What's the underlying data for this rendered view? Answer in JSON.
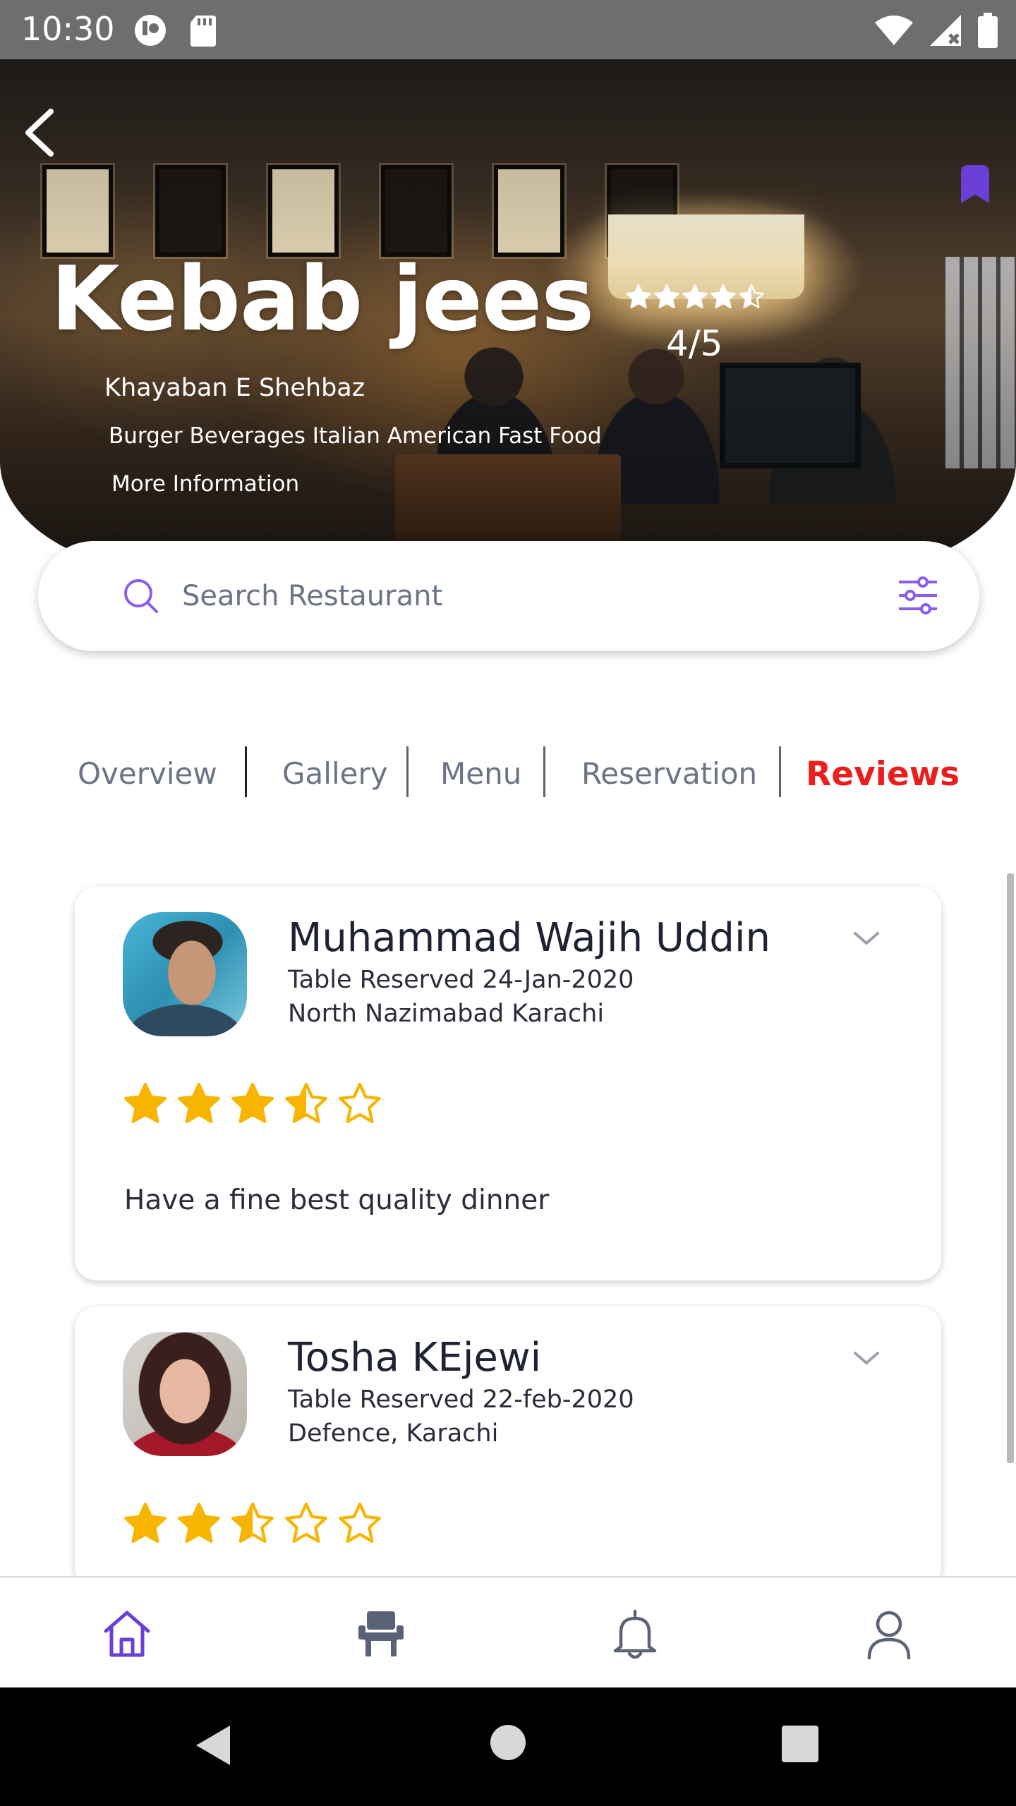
{
  "status_bar": {
    "time": "10:30"
  },
  "restaurant": {
    "name": "Kebab jees",
    "rating_text": "4/5",
    "rating_value": 4.5,
    "area": "Khayaban E Shehbaz",
    "cuisines": "Burger Beverages Italian American Fast Food",
    "more_info": "More Information"
  },
  "search": {
    "placeholder": "Search Restaurant"
  },
  "tabs": [
    {
      "label": "Overview",
      "active": false
    },
    {
      "label": "Gallery",
      "active": false
    },
    {
      "label": "Menu",
      "active": false
    },
    {
      "label": "Reservation",
      "active": false
    },
    {
      "label": "Reviews",
      "active": true
    }
  ],
  "reviews": [
    {
      "name": "Muhammad Wajih Uddin",
      "reserved": "Table Reserved 24-Jan-2020",
      "location": "North Nazimabad Karachi",
      "rating": 3.5,
      "comment": "Have a fine best quality dinner"
    },
    {
      "name": "Tosha KEjewi",
      "reserved": "Table Reserved 22-feb-2020",
      "location": "Defence, Karachi",
      "rating": 2.5,
      "comment": ""
    }
  ],
  "bottom_nav": [
    {
      "icon": "home-icon",
      "active": true
    },
    {
      "icon": "chair-icon",
      "active": false
    },
    {
      "icon": "bell-icon",
      "active": false
    },
    {
      "icon": "user-icon",
      "active": false
    }
  ],
  "colors": {
    "accent": "#6b3fd6",
    "active_tab": "#ec1d1d",
    "star": "#f7b500",
    "muted_text": "#6b7484"
  }
}
